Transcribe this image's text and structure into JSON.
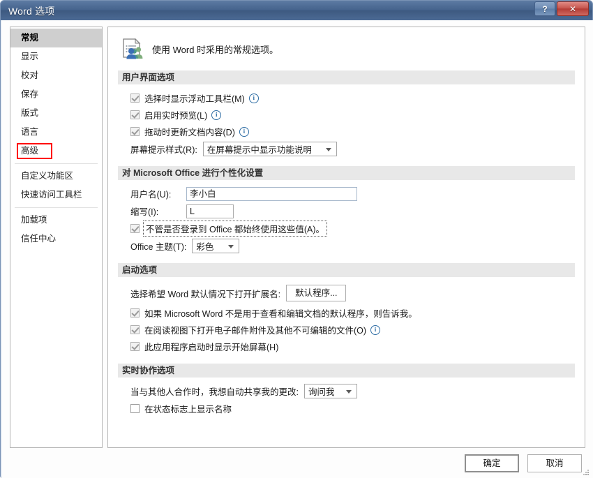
{
  "window": {
    "title": "Word 选项",
    "help_button": "?",
    "close_button": "✕"
  },
  "sidebar": {
    "items": [
      {
        "label": "常规",
        "selected": true,
        "highlighted": false
      },
      {
        "label": "显示",
        "selected": false,
        "highlighted": false
      },
      {
        "label": "校对",
        "selected": false,
        "highlighted": false
      },
      {
        "label": "保存",
        "selected": false,
        "highlighted": false
      },
      {
        "label": "版式",
        "selected": false,
        "highlighted": false
      },
      {
        "label": "语言",
        "selected": false,
        "highlighted": false
      },
      {
        "label": "高级",
        "selected": false,
        "highlighted": true
      },
      {
        "label": "自定义功能区",
        "selected": false,
        "highlighted": false
      },
      {
        "label": "快速访问工具栏",
        "selected": false,
        "highlighted": false
      },
      {
        "label": "加载项",
        "selected": false,
        "highlighted": false
      },
      {
        "label": "信任中心",
        "selected": false,
        "highlighted": false
      }
    ],
    "highlight_color": "#ff0000"
  },
  "header": {
    "icon": "document-people-icon",
    "text": "使用 Word 时采用的常规选项。"
  },
  "sections": {
    "ui_options": {
      "title": "用户界面选项",
      "checkbox_1": "选择时显示浮动工具栏(M)",
      "checkbox_2": "启用实时预览(L)",
      "checkbox_3": "拖动时更新文档内容(D)",
      "screentip_label": "屏幕提示样式(R):",
      "screentip_value": "在屏幕提示中显示功能说明"
    },
    "personalize": {
      "title": "对 Microsoft Office 进行个性化设置",
      "username_label": "用户名(U):",
      "username_value": "李小白",
      "initials_label": "缩写(I):",
      "initials_value": "L",
      "always_use_label": "不管是否登录到 Office 都始终使用这些值(A)。",
      "theme_label": "Office 主题(T):",
      "theme_value": "彩色"
    },
    "startup": {
      "title": "启动选项",
      "default_ext_label": "选择希望 Word 默认情况下打开扩展名:",
      "default_programs_button": "默认程序...",
      "checkbox_1": "如果 Microsoft Word 不是用于查看和编辑文档的默认程序，则告诉我。",
      "checkbox_2": "在阅读视图下打开电子邮件附件及其他不可编辑的文件(O)",
      "checkbox_3": "此应用程序启动时显示开始屏幕(H)"
    },
    "collaboration": {
      "title": "实时协作选项",
      "share_label": "当与其他人合作时，我想自动共享我的更改:",
      "share_value": "询问我",
      "checkbox_1": "在状态标志上显示名称"
    }
  },
  "footer": {
    "ok": "确定",
    "cancel": "取消"
  }
}
